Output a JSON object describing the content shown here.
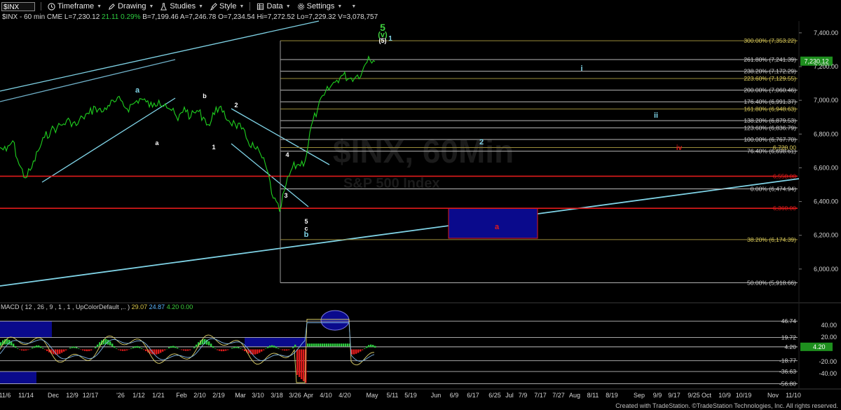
{
  "toolbar": {
    "symbol": "$INX",
    "items": [
      {
        "label": "Timeframe",
        "icon": "clock-icon"
      },
      {
        "label": "Drawing",
        "icon": "pencil-icon"
      },
      {
        "label": "Studies",
        "icon": "flask-icon"
      },
      {
        "label": "Style",
        "icon": "brush-icon"
      },
      {
        "label": "Data",
        "icon": "grid-icon"
      },
      {
        "label": "Settings",
        "icon": "gear-icon"
      }
    ]
  },
  "info": {
    "symbol_text": "$INX - 60 min  CME",
    "last": "L=7,230.12",
    "change": "21.11",
    "pct": "0.29%",
    "bid": "B=7,199.46",
    "ask": "A=7,246.78",
    "open": "O=7,234.54",
    "high": "Hi=7,272.52",
    "low": "Lo=7,229.32",
    "volume": "V=3,078,757"
  },
  "macd": {
    "name": "MACD ( 12 , 26 , 9 , 1 , 1 , UpColorDefault ,.. )",
    "v1": "29.07",
    "v2": "24.87",
    "v3": "4.20",
    "v4": "0.00"
  },
  "credit": "Created with TradeStation. ©TradeStation Technologies, Inc. All rights reserved.",
  "colors": {
    "price": "#1fd01f",
    "cyan": "#7fd3e6",
    "red": "#e01b1b",
    "box": "#0a0a8c",
    "gold": "#b5a642"
  },
  "chart_data": {
    "type": "line",
    "title": "$INX - 60 min",
    "price_axis": {
      "range": [
        5800,
        7470
      ],
      "ticks": [
        "7,400.00",
        "7,200.00",
        "7,000.00",
        "6,800.00",
        "6,600.00",
        "6,400.00",
        "6,200.00",
        "6,000.00"
      ],
      "tick_values": [
        7400,
        7200,
        7000,
        6800,
        6600,
        6400,
        6200,
        6000
      ]
    },
    "macd_axis": {
      "range": [
        -62,
        62
      ],
      "ticks": [
        "40.00",
        "20.00",
        "-20.00",
        "-40.00"
      ],
      "tick_values": [
        40,
        20,
        -20,
        -40
      ]
    },
    "x_ticks": [
      "11/6",
      "11/14",
      "Dec",
      "12/9",
      "12/17",
      "'26",
      "1/12",
      "1/21",
      "Feb",
      "2/10",
      "2/19",
      "Mar",
      "3/10",
      "3/18",
      "3/26",
      "Apr",
      "4/10",
      "4/20",
      "May",
      "5/11",
      "5/19",
      "Jun",
      "6/9",
      "6/17",
      "6/25",
      "Jul",
      "7/9",
      "7/17",
      "7/27",
      "Aug",
      "8/11",
      "8/19",
      "Sep",
      "9/9",
      "9/17",
      "9/25",
      "Oct",
      "10/9",
      "10/19",
      "Nov",
      "11/10"
    ],
    "series": [
      {
        "values": [
          6720,
          6700,
          6760,
          6620,
          6540,
          6600,
          6700,
          6780,
          6820,
          6840,
          6860,
          6880,
          6850,
          6900,
          6920,
          6960,
          6930,
          6970,
          6990,
          7000,
          6950,
          6980,
          7010,
          6990,
          6960,
          7000,
          6980,
          6940,
          6880,
          6960,
          6900,
          6940,
          6900,
          6850,
          6960,
          6930,
          6880,
          6860,
          6830,
          6760,
          6720,
          6680,
          6590,
          6420,
          6340,
          6500,
          6600,
          6620,
          6640,
          6850,
          6950,
          7030,
          7080,
          7120,
          7150,
          7130,
          7140,
          7170,
          7260,
          7230
        ]
      }
    ],
    "price_levels": [
      {
        "label": "300.00% (7,353.22)",
        "value": 7353.22,
        "color": "gold"
      },
      {
        "label": "261.80% (7,241.39)",
        "value": 7241.39,
        "color": "white"
      },
      {
        "label": "238.20% (7,172.29)",
        "value": 7172.29,
        "color": "white"
      },
      {
        "label": "223.60% (7,129.55)",
        "value": 7129.55,
        "color": "gold"
      },
      {
        "label": "200.00% (7,060.46)",
        "value": 7060.46,
        "color": "white"
      },
      {
        "label": "176.40% (6,991.37)",
        "value": 6991.37,
        "color": "white"
      },
      {
        "label": "161.80% (6,948.63)",
        "value": 6948.63,
        "color": "gold"
      },
      {
        "label": "138.20% (6,879.53)",
        "value": 6879.53,
        "color": "white"
      },
      {
        "label": "123.60% (6,836.79)",
        "value": 6836.79,
        "color": "white"
      },
      {
        "label": "100.00% (6,767.70)",
        "value": 6767.7,
        "color": "white"
      },
      {
        "label": "76.40% (6,698.61)",
        "value": 6698.61,
        "color": "white"
      },
      {
        "label": "6,720.00",
        "value": 6720,
        "color": "gold"
      },
      {
        "label": "6,550.00",
        "value": 6550,
        "color": "red"
      },
      {
        "label": "0.00% (6,474.94)",
        "value": 6474.94,
        "color": "white"
      },
      {
        "label": "6,360.00",
        "value": 6360,
        "color": "red"
      },
      {
        "label": "38.20% (6,174.39)",
        "value": 6174.39,
        "color": "gold"
      },
      {
        "label": "50.00% (5,918.66)",
        "value": 5918.66,
        "color": "white"
      }
    ],
    "last_price": "7,230.12",
    "macd_levels": [
      {
        "label": "46.74",
        "value": 46.74
      },
      {
        "label": "19.72",
        "value": 19.72
      },
      {
        "label": "4.20",
        "value": 4.2
      },
      {
        "label": "-18.77",
        "value": -18.77
      },
      {
        "label": "-36.63",
        "value": -36.63
      },
      {
        "label": "-56.80",
        "value": -56.8
      }
    ],
    "wave_labels": [
      {
        "text": "5",
        "color": "#3ed13e"
      },
      {
        "text": "(v)",
        "color": "#3ed13e"
      },
      {
        "text": "(5)",
        "color": "#ffffff"
      },
      {
        "text": "1",
        "color": "#7fd3e6"
      },
      {
        "text": "a",
        "color": "#7fd3e6"
      },
      {
        "text": "b",
        "color": "#ffffff"
      },
      {
        "text": "a",
        "color": "#ffffff"
      },
      {
        "text": "1",
        "color": "#ffffff"
      },
      {
        "text": "2",
        "color": "#ffffff"
      },
      {
        "text": "4",
        "color": "#ffffff"
      },
      {
        "text": "3",
        "color": "#ffffff"
      },
      {
        "text": "5",
        "color": "#ffffff"
      },
      {
        "text": "c",
        "color": "#ffffff"
      },
      {
        "text": "b",
        "color": "#7fd3e6"
      },
      {
        "text": "2",
        "color": "#7fd3e6"
      },
      {
        "text": "i",
        "color": "#7fd3e6"
      },
      {
        "text": "ii",
        "color": "#7fd3e6"
      },
      {
        "text": "iv",
        "color": "#e01b1b"
      },
      {
        "text": "a",
        "color": "#e01b1b"
      }
    ],
    "watermark": "$INX, 60Min",
    "watermark_sub": "S&P 500 Index"
  }
}
